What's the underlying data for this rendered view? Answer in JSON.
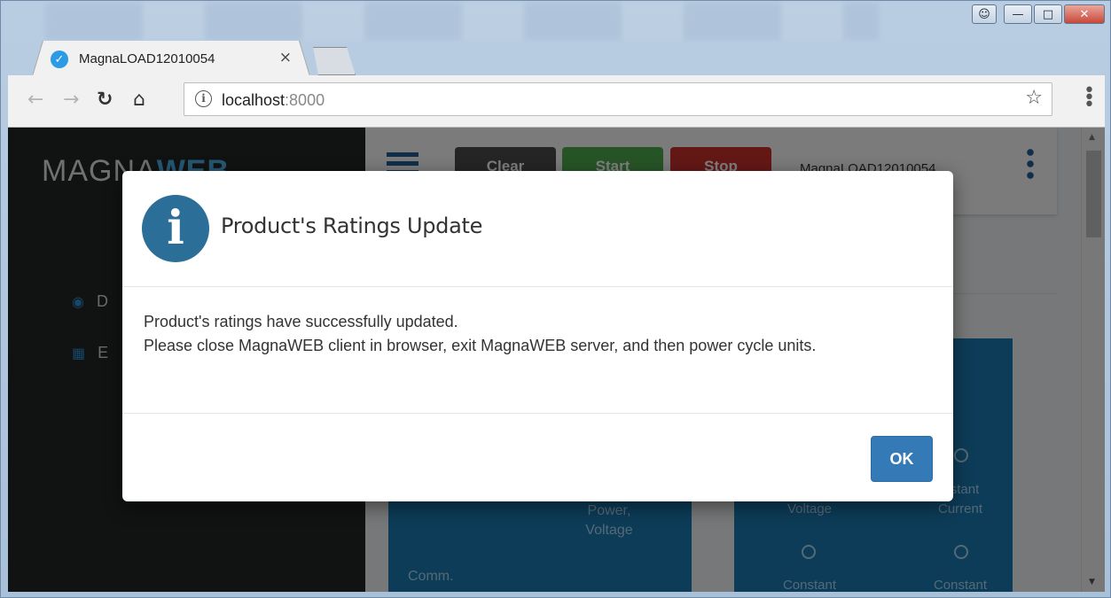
{
  "window": {
    "controls": {
      "user_icon": "user-icon",
      "minimize": "minimize-icon",
      "maximize": "maximize-icon",
      "close": "close-icon"
    }
  },
  "tab": {
    "title": "MagnaLOAD12010054",
    "close_glyph": "×",
    "favicon": "magna-favicon-icon"
  },
  "address_bar": {
    "url_host": "localhost",
    "url_port": ":8000",
    "info_glyph": "i"
  },
  "app": {
    "brand_part1": "MAGNA",
    "brand_part2": "WEB",
    "sidebar_items": [
      {
        "label": "D",
        "icon": "dashboard-icon"
      },
      {
        "label": "E",
        "icon": "grid-icon"
      }
    ],
    "header": {
      "clear_label": "Clear",
      "start_label": "Start",
      "stop_label": "Stop",
      "device_name": "MagnaLOAD12010054"
    },
    "card_a": {
      "power_label": "Power,",
      "voltage_label": "Voltage",
      "comm_label": "Comm."
    },
    "card_b": {
      "voltage_label": "Voltage",
      "constant_current_top": "stant",
      "current_label": "Current",
      "constant_left": "Constant",
      "constant_right": "Constant"
    }
  },
  "modal": {
    "title": "Product's Ratings Update",
    "line1": "Product's ratings have successfully updated.",
    "line2": "Please close MagnaWEB client in browser, exit MagnaWEB server, and then power cycle units.",
    "ok_label": "OK",
    "icon": "info-icon"
  },
  "colors": {
    "accent_blue": "#337ab7",
    "info_icon_bg": "#2b6f98",
    "sidebar_bg": "#222425",
    "card_bg": "#1b79b0",
    "start_green": "#4ea84f",
    "stop_red": "#c9302c"
  }
}
